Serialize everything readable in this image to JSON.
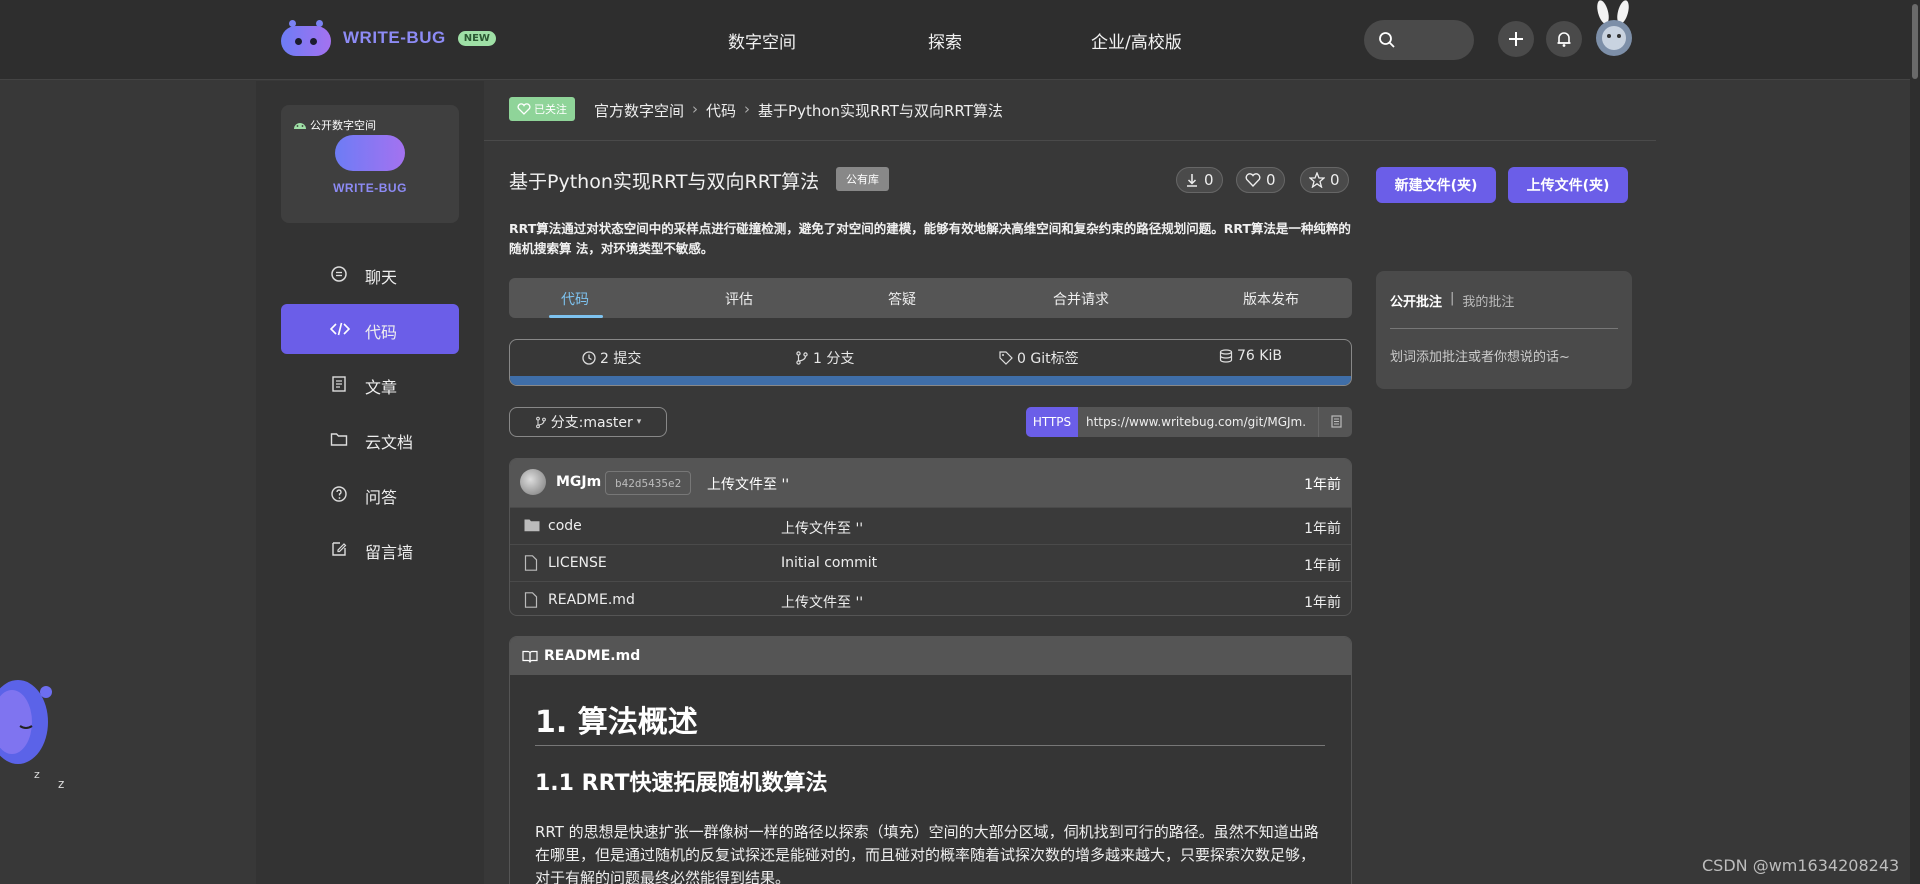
{
  "brand": {
    "name": "WRITE-BUG",
    "new_badge": "NEW"
  },
  "topnav": {
    "items": [
      {
        "label": "数字空间"
      },
      {
        "label": "探索"
      },
      {
        "label": "企业/高校版"
      }
    ]
  },
  "sidebar": {
    "space_label": "公开数字空间",
    "space_brand": "WRITE-BUG",
    "items": [
      {
        "label": "聊天",
        "icon": "chat-icon"
      },
      {
        "label": "代码",
        "icon": "code-icon",
        "active": true
      },
      {
        "label": "文章",
        "icon": "article-icon"
      },
      {
        "label": "云文档",
        "icon": "folder-icon"
      },
      {
        "label": "问答",
        "icon": "question-icon"
      },
      {
        "label": "留言墙",
        "icon": "edit-icon"
      }
    ]
  },
  "breadcrumb": {
    "follow_label": "已关注",
    "items": [
      "官方数字空间",
      "代码",
      "基于Python实现RRT与双向RRT算法"
    ]
  },
  "repo": {
    "title": "基于Python实现RRT与双向RRT算法",
    "visibility": "公有库",
    "downloads": "0",
    "likes": "0",
    "stars": "0",
    "new_file_label": "新建文件(夹)",
    "upload_label": "上传文件(夹)",
    "description": "RRT算法通过对状态空间中的采样点进行碰撞检测，避免了对空间的建模，能够有效地解决高维空间和复杂约束的路径规划问题。RRT算法是一种纯粹的随机搜索算 法，对环境类型不敏感。"
  },
  "tabs": [
    {
      "label": "代码",
      "active": true
    },
    {
      "label": "评估"
    },
    {
      "label": "答疑"
    },
    {
      "label": "合并请求"
    },
    {
      "label": "版本发布"
    }
  ],
  "stats": {
    "commits": "2 提交",
    "branches": "1 分支",
    "tags": "0 Git标签",
    "size": "76 KiB",
    "lang_bar_color": "#3f6ea8"
  },
  "branch": {
    "label": "分支:master"
  },
  "clone": {
    "protocol": "HTTPS",
    "url": "https://www.writebug.com/git/MGJm."
  },
  "files": {
    "last_commit": {
      "author": "MGJm",
      "hash": "b42d5435e2",
      "message": "上传文件至 ''",
      "time": "1年前"
    },
    "rows": [
      {
        "name": "code",
        "type": "folder",
        "message": "上传文件至 ''",
        "time": "1年前"
      },
      {
        "name": "LICENSE",
        "type": "file",
        "message": "Initial commit",
        "time": "1年前"
      },
      {
        "name": "README.md",
        "type": "file",
        "message": "上传文件至 ''",
        "time": "1年前"
      }
    ]
  },
  "readme": {
    "filename": "README.md",
    "h1": "1. 算法概述",
    "h2": "1.1 RRT快速拓展随机数算法",
    "paragraph": "RRT 的思想是快速扩张一群像树一样的路径以探索（填充）空间的大部分区域，伺机找到可行的路径。虽然不知道出路在哪里，但是通过随机的反复试探还是能碰对的，而且碰对的概率随着试探次数的增多越来越大，只要探索次数足够，对于有解的问题最终必然能得到结果。"
  },
  "annotations": {
    "public_tab": "公开批注",
    "separator": "|",
    "mine_tab": "我的批注",
    "hint": "划词添加批注或者你想说的话~"
  },
  "watermark": "CSDN @wm1634208243",
  "colors": {
    "accent": "#6b5ee8",
    "follow_green": "#8fd499",
    "tab_active": "#7ec3f0"
  }
}
